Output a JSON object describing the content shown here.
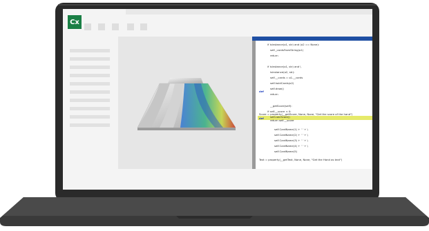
{
  "app": {
    "logo_text": "Cx"
  },
  "code": {
    "lines": [
      "if isinstance(o1, str) and (o2 == None):",
      "self._cardsFromString(o1)",
      "return",
      "if isinstance(o1, str) and \\",
      "isinstance(o2, str):",
      "self.__cards = o1.__cards",
      "self.holdCards(o2)",
      "self.draw()",
      "return",
      "__getScore(self):",
      "if self.__score < 0:",
      "self.calcScore()",
      "return self.__score",
      "self.CardName(1) + ' ' + \\",
      "self.CardName(2) + ' ' + \\",
      "self.CardName(3) + ' ' + \\",
      "self.CardName(4) + ' ' + \\",
      "self.CardName(5)"
    ],
    "score_line": "Score = property(__getScore, None, None, \"Get the score of the hand\")",
    "text_line": "Text = property(__getText, None, None, \"Get the Hand as text\")",
    "def_label": "def",
    "def_label_2": "def",
    "return_line": "return self.__score"
  }
}
